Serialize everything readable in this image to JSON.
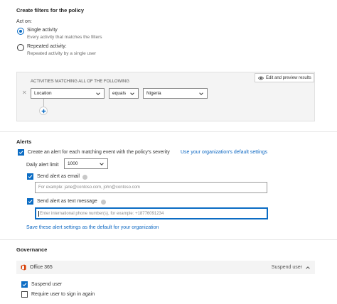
{
  "filters": {
    "heading": "Create filters for the policy",
    "act_on_label": "Act on:",
    "single": {
      "label": "Single activity",
      "desc": "Every activity that matches the filters",
      "selected": true
    },
    "repeated": {
      "label": "Repeated activity:",
      "desc": "Repeated activity by a single user",
      "selected": false
    },
    "preview_button": "Edit and preview results",
    "box_title": "ACTIVITIES MATCHING ALL OF THE FOLLOWING",
    "row": {
      "field": "Location",
      "operator": "equals",
      "value": "Nigeria"
    }
  },
  "alerts": {
    "heading": "Alerts",
    "create_label": "Create an alert for each matching event with the policy's severity",
    "default_link": "Use your organization's default settings",
    "daily_limit_label": "Daily alert limit",
    "daily_limit_value": "1000",
    "email_label": "Send alert as email",
    "email_placeholder": "For example: jane@contoso.com, john@contoso.com",
    "sms_label": "Send alert as text message",
    "sms_placeholder": "Enter international phone number(s), for example: +18776091234",
    "save_default_link": "Save these alert settings as the default for your organization"
  },
  "governance": {
    "heading": "Governance",
    "app_name": "Office 365",
    "action_label": "Suspend user",
    "suspend_label": "Suspend user",
    "require_signin_label": "Require user to sign in again"
  },
  "colors": {
    "accent": "#0b6cc4",
    "office_red": "#d83b01",
    "link": "#0a66c2"
  }
}
